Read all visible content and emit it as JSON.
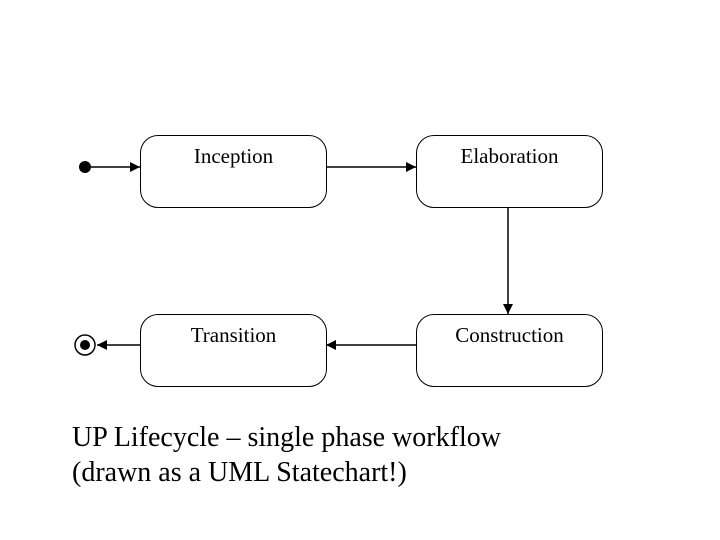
{
  "states": {
    "inception": "Inception",
    "elaboration": "Elaboration",
    "transition": "Transition",
    "construction": "Construction"
  },
  "caption_line1": "UP Lifecycle – single phase workflow",
  "caption_line2": "(drawn as a UML Statechart!)"
}
